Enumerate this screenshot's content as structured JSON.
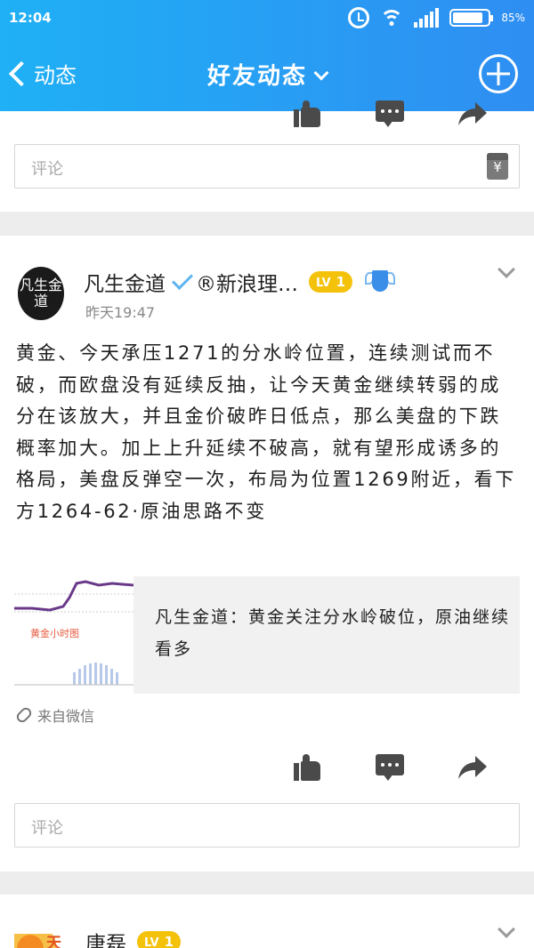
{
  "status_bar": {
    "time": "12:04",
    "battery": "85%",
    "battery_level": 0.85
  },
  "nav": {
    "back_label": "动态",
    "title": "好友动态"
  },
  "prev_post": {
    "cut_text": "……",
    "comment_placeholder": "评论"
  },
  "post": {
    "author": "凡生金道",
    "author_suffix": "®新浪理…",
    "level": "LV",
    "level_num": "1",
    "time": "昨天19:47",
    "avatar_text": "凡生金道",
    "content": "黄金、今天承压1271的分水岭位置，连续测试而不破，而欧盘没有延续反抽，让今天黄金继续转弱的成分在该放大，并且金价破昨日低点，那么美盘的下跌概率加大。加上上升延续不破高，就有望形成诱多的格局，美盘反弹空一次，布局为位置1269附近，看下方1264-62·原油思路不变",
    "share": {
      "thumb_label": "黄金小时图",
      "title": "凡生金道：黄金关注分水岭破位，原油继续看多"
    },
    "source": "来自微信",
    "comment_placeholder": "评论"
  },
  "next_post": {
    "author": "唐磊",
    "avatar_text": "天",
    "level": "LV",
    "level_num": "1"
  },
  "colors": {
    "nav_start": "#1fb0f5",
    "nav_end": "#2f8ef2",
    "level_badge": "#f4c10b",
    "verify": "#5fb4ef"
  }
}
